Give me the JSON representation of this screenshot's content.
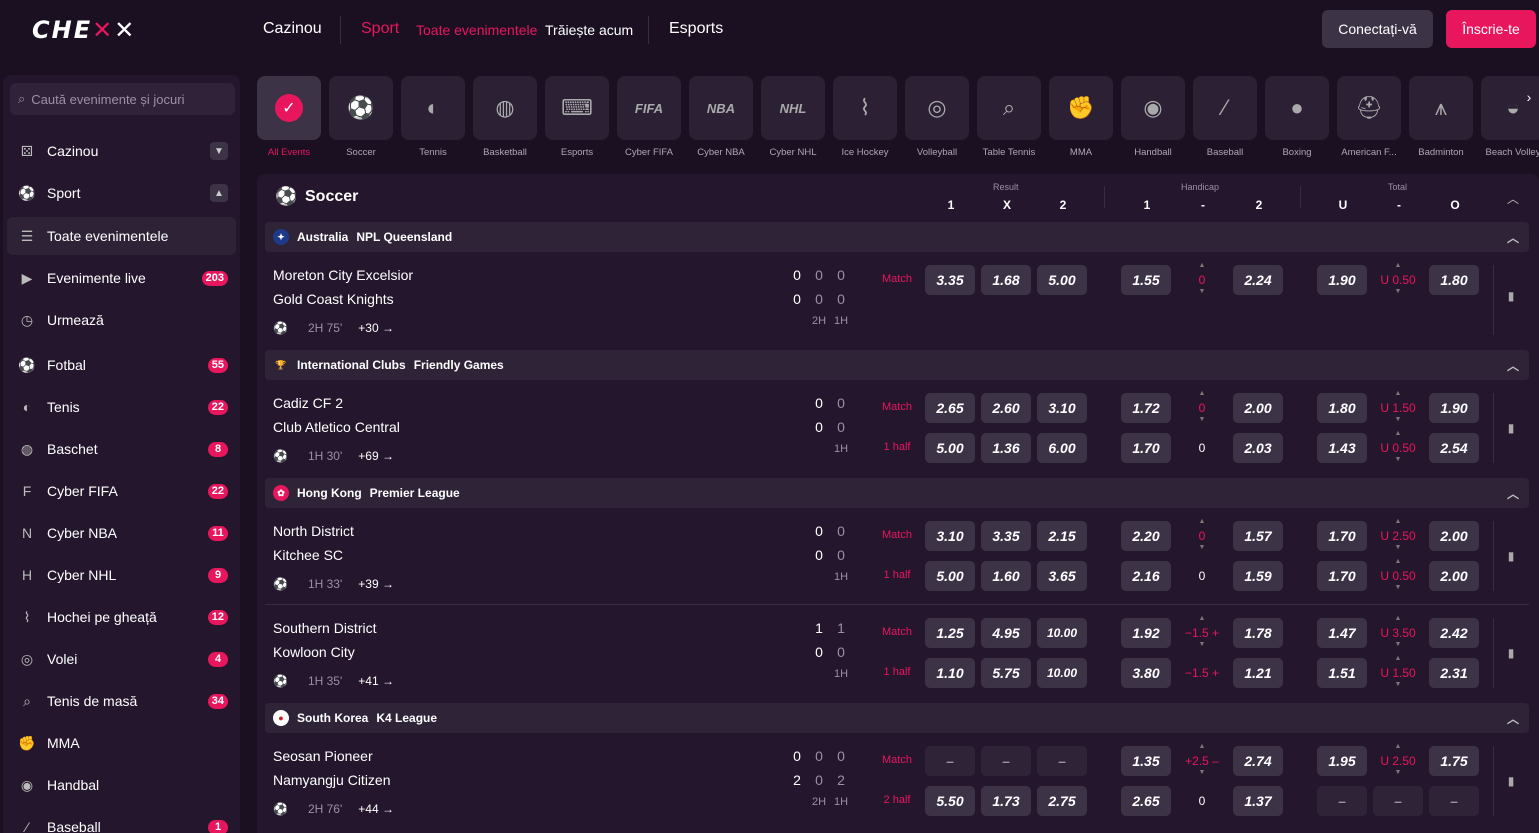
{
  "brand": {
    "logo_text": "CHEXXX",
    "accent": "#e8175d"
  },
  "nav": {
    "casino": "Cazinou",
    "sport": "Sport",
    "all_events": "Toate evenimentele",
    "live": "Trăiește acum",
    "esports": "Esports"
  },
  "auth": {
    "login": "Conectați-vă",
    "register": "Înscrie-te"
  },
  "search": {
    "placeholder": "Caută evenimente și jocuri"
  },
  "sidebar": [
    {
      "label": "Cazinou",
      "icon": "dice-icon",
      "chevron": "down"
    },
    {
      "label": "Sport",
      "icon": "sport-icon",
      "chevron": "up"
    },
    {
      "label": "Toate evenimentele",
      "icon": "list-icon",
      "highlight": true
    },
    {
      "label": "Evenimente live",
      "icon": "play-icon",
      "badge": "203"
    },
    {
      "label": "Urmează",
      "icon": "clock-icon"
    },
    {
      "label": "Fotbal",
      "icon": "soccer-icon",
      "badge": "55"
    },
    {
      "label": "Tenis",
      "icon": "tennis-icon",
      "badge": "22"
    },
    {
      "label": "Baschet",
      "icon": "basketball-icon",
      "badge": "8"
    },
    {
      "label": "Cyber FIFA",
      "icon": "fifa-icon",
      "badge": "22"
    },
    {
      "label": "Cyber NBA",
      "icon": "nba-icon",
      "badge": "11"
    },
    {
      "label": "Cyber NHL",
      "icon": "nhl-icon",
      "badge": "9"
    },
    {
      "label": "Hochei pe gheață",
      "icon": "hockey-icon",
      "badge": "12"
    },
    {
      "label": "Volei",
      "icon": "volleyball-icon",
      "badge": "4"
    },
    {
      "label": "Tenis de masă",
      "icon": "table-tennis-icon",
      "badge": "34"
    },
    {
      "label": "MMA",
      "icon": "mma-icon"
    },
    {
      "label": "Handbal",
      "icon": "handball-icon"
    },
    {
      "label": "Baseball",
      "icon": "baseball-icon",
      "badge": "1"
    }
  ],
  "sports": [
    {
      "label": "All Events",
      "icon": "check-icon",
      "active": true
    },
    {
      "label": "Soccer",
      "icon": "soccer-icon"
    },
    {
      "label": "Tennis",
      "icon": "tennis-icon"
    },
    {
      "label": "Basketball",
      "icon": "basketball-icon"
    },
    {
      "label": "Esports",
      "icon": "gamepad-icon"
    },
    {
      "label": "Cyber FIFA",
      "icon": "fifa-icon",
      "text": "FIFA"
    },
    {
      "label": "Cyber NBA",
      "icon": "nba-icon",
      "text": "NBA"
    },
    {
      "label": "Cyber NHL",
      "icon": "nhl-icon",
      "text": "NHL"
    },
    {
      "label": "Ice Hockey",
      "icon": "hockey-icon"
    },
    {
      "label": "Volleyball",
      "icon": "volleyball-icon"
    },
    {
      "label": "Table Tennis",
      "icon": "table-tennis-icon"
    },
    {
      "label": "MMA",
      "icon": "mma-icon"
    },
    {
      "label": "Handball",
      "icon": "handball-icon"
    },
    {
      "label": "Baseball",
      "icon": "baseball-icon"
    },
    {
      "label": "Boxing",
      "icon": "boxing-icon"
    },
    {
      "label": "American F...",
      "icon": "football-helmet-icon"
    },
    {
      "label": "Badminton",
      "icon": "shuttlecock-icon"
    },
    {
      "label": "Beach Volley",
      "icon": "beach-volley-icon"
    }
  ],
  "table": {
    "title": "Soccer",
    "groups": {
      "result": "Result",
      "handicap": "Handicap",
      "total": "Total"
    },
    "cols": {
      "r1": "1",
      "rx": "X",
      "r2": "2",
      "h1": "1",
      "hdash": "-",
      "h2": "2",
      "tu": "U",
      "tdash": "-",
      "to": "O"
    }
  },
  "leagues": [
    {
      "country": "Australia",
      "name": "NPL Queensland",
      "flag": "australia-flag-icon"
    },
    {
      "country": "International Clubs",
      "name": "Friendly Games",
      "flag": "trophy-icon"
    },
    {
      "country": "Hong Kong",
      "name": "Premier League",
      "flag": "hong-kong-flag-icon"
    },
    {
      "country": "South Korea",
      "name": "K4 League",
      "flag": "korea-flag-icon"
    }
  ],
  "matches": [
    {
      "home": "Moreton City Excelsior",
      "away": "Gold Coast Knights",
      "time": "2H 75'",
      "more": "+30 →",
      "scores": [
        [
          "0",
          "0",
          "0"
        ],
        [
          "0",
          "0",
          "0"
        ]
      ],
      "periods": [
        "2H",
        "1H"
      ],
      "lines": [
        {
          "type": "Match",
          "r": [
            "3.35",
            "1.68",
            "5.00"
          ],
          "h1": "1.55",
          "hl": "0",
          "h2": "2.24",
          "tu": "1.90",
          "tl": "U 0.50",
          "to": "1.80"
        }
      ]
    },
    {
      "home": "Cadiz CF 2",
      "away": "Club Atletico Central",
      "time": "1H 30'",
      "more": "+69 →",
      "scores": [
        [
          "0",
          "0"
        ],
        [
          "0",
          "0"
        ]
      ],
      "periods": [
        "1H"
      ],
      "lines": [
        {
          "type": "Match",
          "r": [
            "2.65",
            "2.60",
            "3.10"
          ],
          "h1": "1.72",
          "hl": "0",
          "h2": "2.00",
          "tu": "1.80",
          "tl": "U 1.50",
          "to": "1.90"
        },
        {
          "type": "1 half",
          "r": [
            "5.00",
            "1.36",
            "6.00"
          ],
          "h1": "1.70",
          "hl": "0",
          "h2": "2.03",
          "tu": "1.43",
          "tl": "U 0.50",
          "to": "2.54"
        }
      ]
    },
    {
      "home": "North District",
      "away": "Kitchee SC",
      "time": "1H 33'",
      "more": "+39 →",
      "scores": [
        [
          "0",
          "0"
        ],
        [
          "0",
          "0"
        ]
      ],
      "periods": [
        "1H"
      ],
      "lines": [
        {
          "type": "Match",
          "r": [
            "3.10",
            "3.35",
            "2.15"
          ],
          "h1": "2.20",
          "hl": "0",
          "h2": "1.57",
          "tu": "1.70",
          "tl": "U 2.50",
          "to": "2.00"
        },
        {
          "type": "1 half",
          "r": [
            "5.00",
            "1.60",
            "3.65"
          ],
          "h1": "2.16",
          "hl": "0",
          "h2": "1.59",
          "tu": "1.70",
          "tl": "U 0.50",
          "to": "2.00"
        }
      ]
    },
    {
      "home": "Southern District",
      "away": "Kowloon City",
      "time": "1H 35'",
      "more": "+41 →",
      "scores": [
        [
          "1",
          "1"
        ],
        [
          "0",
          "0"
        ]
      ],
      "periods": [
        "1H"
      ],
      "lines": [
        {
          "type": "Match",
          "r": [
            "1.25",
            "4.95",
            "10.00"
          ],
          "h1": "1.92",
          "hl": "−1.5 +",
          "h2": "1.78",
          "tu": "1.47",
          "tl": "U 3.50",
          "to": "2.42"
        },
        {
          "type": "1 half",
          "r": [
            "1.10",
            "5.75",
            "10.00"
          ],
          "h1": "3.80",
          "hl": "−1.5 +",
          "h2": "1.21",
          "tu": "1.51",
          "tl": "U 1.50",
          "to": "2.31"
        }
      ]
    },
    {
      "home": "Seosan Pioneer",
      "away": "Namyangju Citizen",
      "time": "2H 76'",
      "more": "+44 →",
      "scores": [
        [
          "0",
          "0",
          "0"
        ],
        [
          "2",
          "0",
          "2"
        ]
      ],
      "periods": [
        "2H",
        "1H"
      ],
      "lines": [
        {
          "type": "Match",
          "r": [
            "–",
            "–",
            "–"
          ],
          "h1": "1.35",
          "hl": "+2.5 –",
          "h2": "2.74",
          "tu": "1.95",
          "tl": "U 2.50",
          "to": "1.75"
        },
        {
          "type": "2 half",
          "r": [
            "5.50",
            "1.73",
            "2.75"
          ],
          "h1": "2.65",
          "hl": "0",
          "h2": "1.37",
          "tu": "–",
          "tl": "–",
          "to": "–"
        }
      ]
    }
  ]
}
